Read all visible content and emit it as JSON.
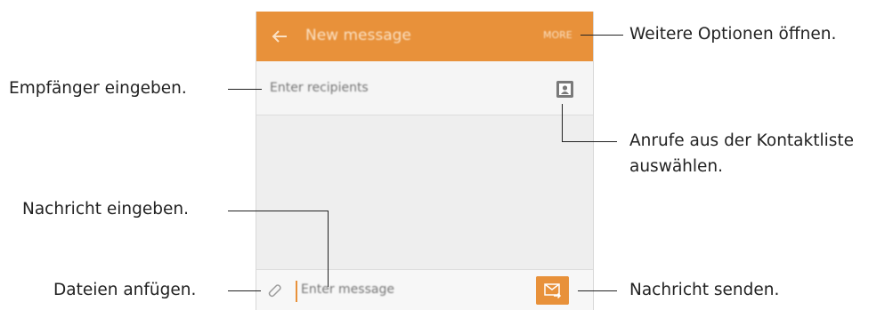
{
  "app": {
    "title": "New message",
    "more_label": "MORE",
    "back_icon": "arrow-left-icon",
    "accent_color": "#e8913a"
  },
  "recipients": {
    "placeholder": "Enter recipients",
    "contact_icon": "contact-icon"
  },
  "composer": {
    "placeholder": "Enter message",
    "attach_icon": "paperclip-icon",
    "send_icon": "envelope-send-icon"
  },
  "callouts": {
    "more_options": "Weitere Optionen öffnen.",
    "enter_recipients": "Empfänger eingeben.",
    "contacts_line1": "Anrufe aus der Kontaktliste",
    "contacts_line2": "auswählen.",
    "enter_message": "Nachricht eingeben.",
    "attach_files": "Dateien anfügen.",
    "send_message": "Nachricht senden."
  }
}
